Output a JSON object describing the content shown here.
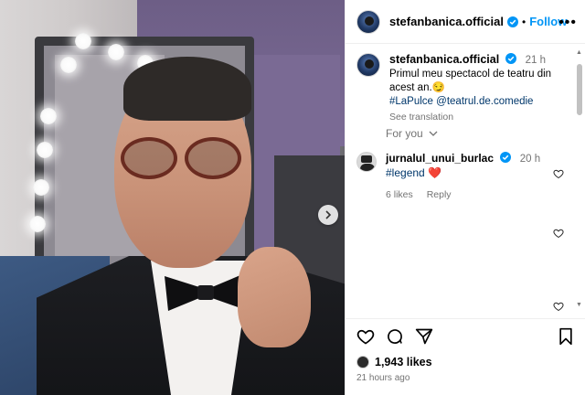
{
  "post": {
    "author": "stefanbanica.official",
    "follow_label": "Follow",
    "more_icon": "more-horizontal-icon",
    "separator": "•"
  },
  "caption": {
    "username": "stefanbanica.official",
    "time": "21 h",
    "text": "Primul meu spectacol de teatru din acest an.",
    "emoji": "😏",
    "hashtag": "#LaPulce",
    "mention": "@teatrul.de.comedie",
    "see_translation": "See translation"
  },
  "for_you": {
    "label": "For you",
    "chevron_icon": "chevron-down-icon"
  },
  "comments": [
    {
      "username": "jurnalul_unui_burlac",
      "time": "20 h",
      "text": "#legend",
      "emoji": "❤️",
      "likes": "6 likes",
      "reply": "Reply"
    }
  ],
  "actions": {
    "likes_count": "1,943 likes",
    "posted": "21 hours ago"
  },
  "colors": {
    "accent": "#0095f6",
    "link": "#00376b",
    "muted": "#737373",
    "heart": "#ed4956"
  }
}
